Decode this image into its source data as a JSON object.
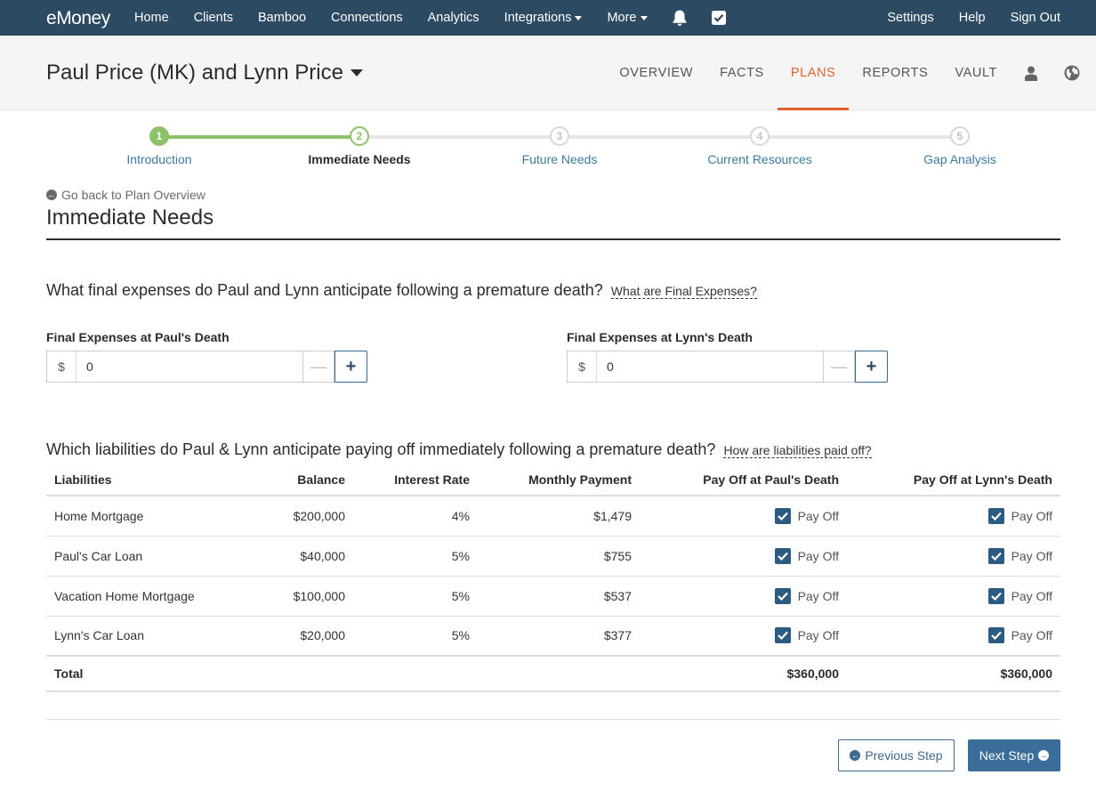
{
  "colors": {
    "nav_bg": "#2d4a63",
    "accent_active": "#e0612f",
    "step_done": "#8dc26b",
    "primary_button": "#3a6d99",
    "link": "#3d7a9e"
  },
  "topnav": {
    "logo_e": "e",
    "logo_rest": "Money",
    "items": [
      {
        "label": "Home"
      },
      {
        "label": "Clients"
      },
      {
        "label": "Bamboo"
      },
      {
        "label": "Connections"
      },
      {
        "label": "Analytics"
      },
      {
        "label": "Integrations"
      },
      {
        "label": "More"
      }
    ],
    "icons": [
      "bell-icon",
      "checkbox-icon"
    ],
    "right_items": [
      {
        "label": "Settings"
      },
      {
        "label": "Help"
      },
      {
        "label": "Sign Out"
      }
    ]
  },
  "client": {
    "name": "Paul Price (MK) and Lynn Price",
    "tabs": [
      {
        "label": "OVERVIEW"
      },
      {
        "label": "FACTS"
      },
      {
        "label": "PLANS"
      },
      {
        "label": "REPORTS"
      },
      {
        "label": "VAULT"
      }
    ],
    "active_tab": "PLANS",
    "icons": [
      "user-icon",
      "globe-icon"
    ]
  },
  "stepper": {
    "steps": [
      {
        "num": "1",
        "label": "Introduction",
        "state": "done"
      },
      {
        "num": "2",
        "label": "Immediate Needs",
        "state": "current"
      },
      {
        "num": "3",
        "label": "Future Needs",
        "state": "pending"
      },
      {
        "num": "4",
        "label": "Current Resources",
        "state": "pending"
      },
      {
        "num": "5",
        "label": "Gap Analysis",
        "state": "pending"
      }
    ]
  },
  "page": {
    "back_link": "Go back to Plan Overview",
    "title": "Immediate Needs"
  },
  "final_expenses": {
    "question": "What final expenses do Paul and Lynn anticipate following a premature death?",
    "help_link": "What are Final Expenses?",
    "fields": [
      {
        "label": "Final Expenses at Paul's Death",
        "prefix": "$",
        "value": "0"
      },
      {
        "label": "Final Expenses at Lynn's Death",
        "prefix": "$",
        "value": "0"
      }
    ]
  },
  "liabilities": {
    "question": "Which liabilities do Paul & Lynn anticipate paying off immediately following a premature death?",
    "help_link": "How are liabilities paid off?",
    "headers": {
      "name": "Liabilities",
      "balance": "Balance",
      "rate": "Interest Rate",
      "payment": "Monthly Payment",
      "paul": "Pay Off at Paul's Death",
      "lynn": "Pay Off at Lynn's Death"
    },
    "rows": [
      {
        "name": "Home Mortgage",
        "balance": "$200,000",
        "rate": "4%",
        "payment": "$1,479",
        "paul_label": "Pay Off",
        "lynn_label": "Pay Off",
        "paul_checked": true,
        "lynn_checked": true
      },
      {
        "name": "Paul's Car Loan",
        "balance": "$40,000",
        "rate": "5%",
        "payment": "$755",
        "paul_label": "Pay Off",
        "lynn_label": "Pay Off",
        "paul_checked": true,
        "lynn_checked": true
      },
      {
        "name": "Vacation Home Mortgage",
        "balance": "$100,000",
        "rate": "5%",
        "payment": "$537",
        "paul_label": "Pay Off",
        "lynn_label": "Pay Off",
        "paul_checked": true,
        "lynn_checked": true
      },
      {
        "name": "Lynn's Car Loan",
        "balance": "$20,000",
        "rate": "5%",
        "payment": "$377",
        "paul_label": "Pay Off",
        "lynn_label": "Pay Off",
        "paul_checked": true,
        "lynn_checked": true
      }
    ],
    "total": {
      "label": "Total",
      "paul": "$360,000",
      "lynn": "$360,000"
    }
  },
  "footer": {
    "prev_label": "Previous Step",
    "next_label": "Next Step"
  }
}
